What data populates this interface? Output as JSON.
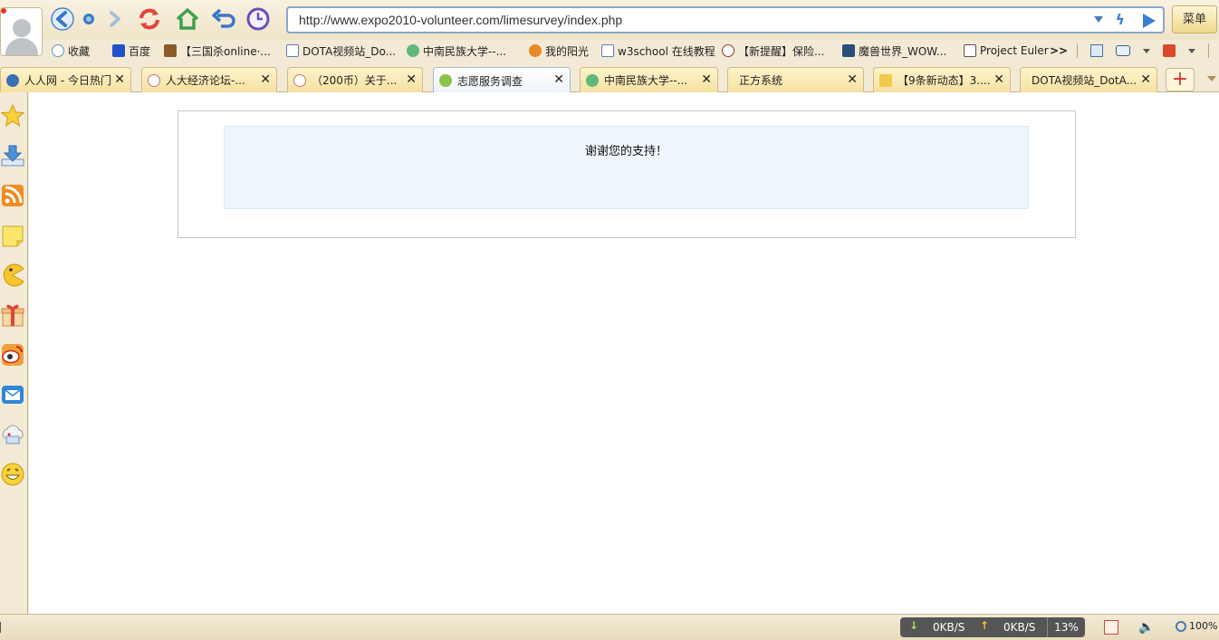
{
  "toolbar": {
    "address": "http://www.expo2010-volunteer.com/limesurvey/index.php",
    "menu_label": "菜单"
  },
  "bookmarks": [
    {
      "label": "收藏",
      "icon": "star-outline-icon"
    },
    {
      "label": "百度",
      "icon": "baidu-paw-icon"
    },
    {
      "label": "【三国杀online·...",
      "icon": "sanguosha-icon"
    },
    {
      "label": "DOTA视频站_Do...",
      "icon": "page-icon"
    },
    {
      "label": "中南民族大学--...",
      "icon": "university-icon"
    },
    {
      "label": "我的阳光",
      "icon": "sun-badge-icon"
    },
    {
      "label": "w3school 在线教程",
      "icon": "page-icon"
    },
    {
      "label": "【新提醒】保险...",
      "icon": "e-forum-icon"
    },
    {
      "label": "魔兽世界_WOW...",
      "icon": "wow-icon"
    },
    {
      "label": "Project Euler",
      "icon": "pe-icon"
    }
  ],
  "bookmark_overflow": ">>",
  "tabs": [
    {
      "title": "人人网 - 今日热门",
      "icon": "renren-icon",
      "active": false
    },
    {
      "title": "人大经济论坛-...",
      "icon": "e-forum-icon",
      "active": false
    },
    {
      "title": "（200币）关于...",
      "icon": "e-forum-icon",
      "active": false
    },
    {
      "title": "志愿服务调查",
      "icon": "limesurvey-icon",
      "active": true
    },
    {
      "title": "中南民族大学--...",
      "icon": "university-icon",
      "active": false
    },
    {
      "title": "正方系统",
      "icon": "page-icon",
      "active": false
    },
    {
      "title": "【9条新动态】3....",
      "icon": "star-icon",
      "active": false
    },
    {
      "title": "DOTA视频站_DotA...",
      "icon": "page-icon",
      "active": false
    }
  ],
  "content": {
    "message": "谢谢您的支持！"
  },
  "statusbar": {
    "download_speed": "0KB/S",
    "upload_speed": "0KB/S",
    "cpu": "13%",
    "zoom": "100%"
  },
  "colors": {
    "chrome_bg": "#f3ead6",
    "tab_bg": "#f5e1a0",
    "active_tab_bg": "#eef2f8",
    "message_bg": "#eef5fd",
    "accent_blue": "#3a7fd0"
  }
}
